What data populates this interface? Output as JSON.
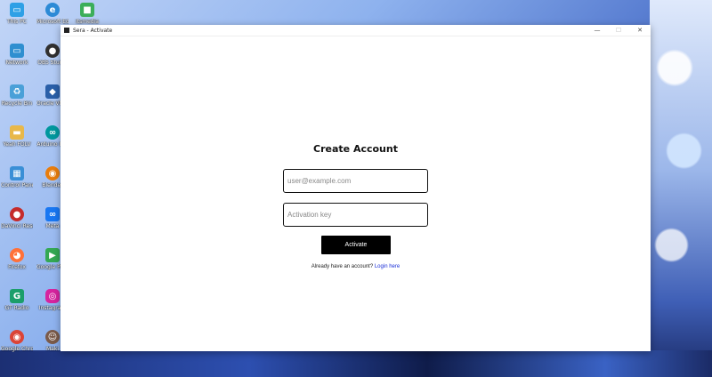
{
  "desktop": {
    "icons": [
      {
        "label": "This PC",
        "icon": "monitor-icon",
        "color": "#2ea0e6"
      },
      {
        "label": "Microsoft Edge",
        "icon": "edge-icon",
        "color": "#2c8ad6"
      },
      {
        "label": "itsmedia",
        "icon": "cube-icon",
        "color": "#3cae5a"
      },
      {
        "label": "Network",
        "icon": "network-icon",
        "color": "#2f8fd0"
      },
      {
        "label": "OBS Studio",
        "icon": "obs-icon",
        "color": "#303030"
      },
      {
        "label": "Recycle Bin",
        "icon": "recycle-bin-icon",
        "color": "#4aa0d8"
      },
      {
        "label": "Oracle VM VirtualBox",
        "icon": "virtualbox-icon",
        "color": "#2a5fa8"
      },
      {
        "label": "Yeah FOLV",
        "icon": "folder-icon",
        "color": "#e8b84a"
      },
      {
        "label": "Arduino IDE",
        "icon": "arduino-icon",
        "color": "#00979d"
      },
      {
        "label": "Control Panel",
        "icon": "control-panel-icon",
        "color": "#3a8fd6"
      },
      {
        "label": "Blender",
        "icon": "blender-icon",
        "color": "#e87d0d"
      },
      {
        "label": "DaVinci Resolve",
        "icon": "davinci-icon",
        "color": "#c52b2b"
      },
      {
        "label": "Meta",
        "icon": "meta-icon",
        "color": "#1877f2"
      },
      {
        "label": "Firefox",
        "icon": "firefox-icon",
        "color": "#ff7139"
      },
      {
        "label": "Google Play Games",
        "icon": "play-games-icon",
        "color": "#34a853"
      },
      {
        "label": "GT Radio",
        "icon": "gt-radio-icon",
        "color": "#1b9e6a"
      },
      {
        "label": "Instagram",
        "icon": "instagram-icon",
        "color": "#d6249f"
      },
      {
        "label": "Google Chrome",
        "icon": "chrome-icon",
        "color": "#db4437"
      },
      {
        "label": "Maki",
        "icon": "avatar-icon",
        "color": "#7a5a4a"
      }
    ]
  },
  "window": {
    "title": "Sera - Activate",
    "minimize": "—",
    "maximize": "☐",
    "close": "✕"
  },
  "form": {
    "heading": "Create Account",
    "email_placeholder": "user@example.com",
    "key_placeholder": "Activation key",
    "activate_label": "Activate",
    "login_prompt": "Already have an account?",
    "login_link": "Login here"
  }
}
